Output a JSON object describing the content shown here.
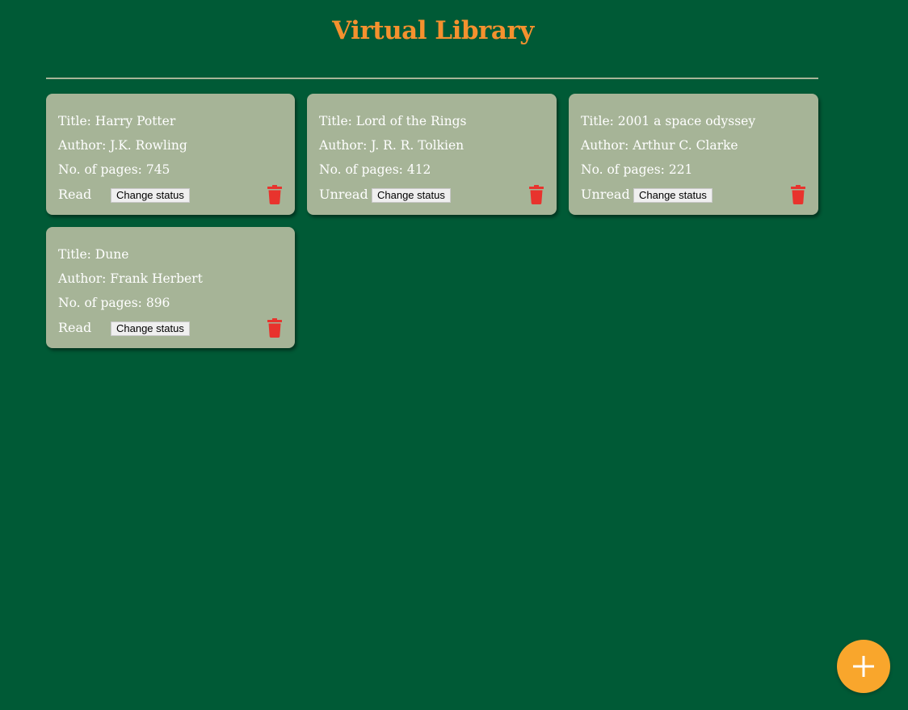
{
  "header": {
    "title": "Virtual Library"
  },
  "books": [
    {
      "title": "Title: Harry Potter",
      "author": "Author: J.K. Rowling",
      "pages": "No. of pages: 745",
      "status": "Read",
      "change_status_label": "Change status"
    },
    {
      "title": "Title: Lord of the Rings",
      "author": "Author: J. R. R. Tolkien",
      "pages": "No. of pages: 412",
      "status": "Unread",
      "change_status_label": "Change status"
    },
    {
      "title": "Title: 2001 a space odyssey",
      "author": "Author: Arthur C. Clarke",
      "pages": "No. of pages: 221",
      "status": "Unread",
      "change_status_label": "Change status"
    },
    {
      "title": "Title: Dune",
      "author": "Author: Frank Herbert",
      "pages": "No. of pages: 896",
      "status": "Read",
      "change_status_label": "Change status"
    }
  ],
  "icons": {
    "delete": "trash-icon",
    "add": "plus-icon"
  },
  "colors": {
    "background": "#005a36",
    "title": "#f5912e",
    "card": "#a6b497",
    "delete_icon": "#e8332d",
    "add_button": "#f9a62c"
  }
}
